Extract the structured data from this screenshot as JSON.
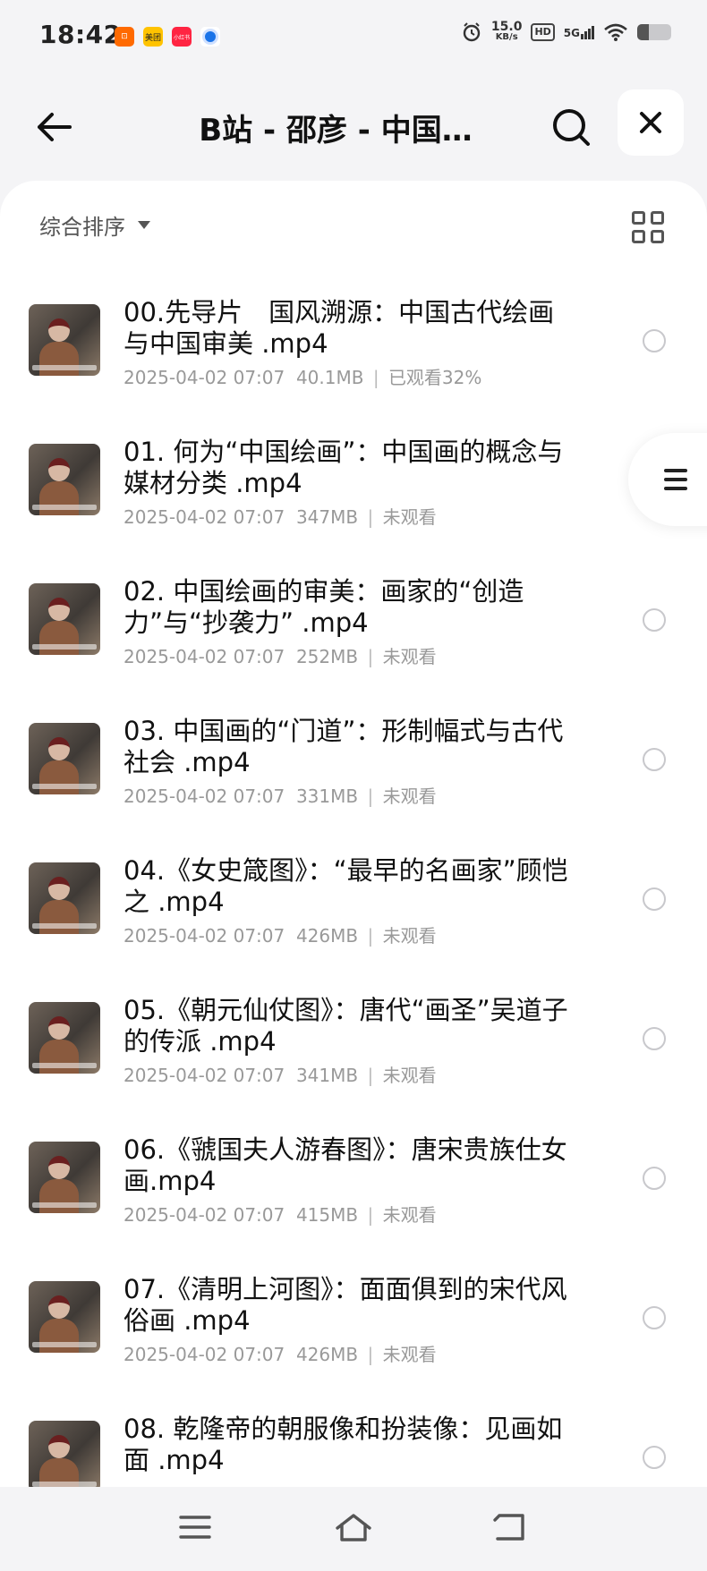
{
  "status_bar": {
    "time": "18:42",
    "apps": [
      {
        "icon": "taobao-app-icon",
        "color": "#ff6a00",
        "label": ""
      },
      {
        "icon": "meituan-app-icon",
        "color": "#ffc300",
        "label": "美团"
      },
      {
        "icon": "xiaohongshu-app-icon",
        "color": "#ff2442",
        "label": "小红书"
      },
      {
        "icon": "blue-app-icon",
        "color": "#1a73e8",
        "label": ""
      }
    ],
    "net_speed_value": "15.0",
    "net_speed_unit": "KB/s",
    "hd_badge": "HD",
    "network": "5G",
    "battery_level": 0.35
  },
  "header": {
    "title": "B站 - 邵彦 - 中国…"
  },
  "sort": {
    "label": "综合排序"
  },
  "files": [
    {
      "name": "00.先导片　国风溯源：中国古代绘画与中国审美 .mp4",
      "date": "2025-04-02 07:07",
      "size": "40.1MB",
      "status": "已观看32%"
    },
    {
      "name": "01. 何为“中国绘画”：中国画的概念与媒材分类 .mp4",
      "date": "2025-04-02 07:07",
      "size": "347MB",
      "status": "未观看"
    },
    {
      "name": "02. 中国绘画的审美：画家的“创造力”与“抄袭力” .mp4",
      "date": "2025-04-02 07:07",
      "size": "252MB",
      "status": "未观看"
    },
    {
      "name": "03. 中国画的“门道”：形制幅式与古代社会 .mp4",
      "date": "2025-04-02 07:07",
      "size": "331MB",
      "status": "未观看"
    },
    {
      "name": "04.《女史箴图》：“最早的名画家”顾恺之 .mp4",
      "date": "2025-04-02 07:07",
      "size": "426MB",
      "status": "未观看"
    },
    {
      "name": "05.《朝元仙仗图》：唐代“画圣”吴道子的传派 .mp4",
      "date": "2025-04-02 07:07",
      "size": "341MB",
      "status": "未观看"
    },
    {
      "name": "06.《虢国夫人游春图》：唐宋贵族仕女画.mp4",
      "date": "2025-04-02 07:07",
      "size": "415MB",
      "status": "未观看"
    },
    {
      "name": "07.《清明上河图》：面面俱到的宋代风俗画 .mp4",
      "date": "2025-04-02 07:07",
      "size": "426MB",
      "status": "未观看"
    },
    {
      "name": "08. 乾隆帝的朝服像和扮装像：见画如面 .mp4",
      "date": "",
      "size": "",
      "status": ""
    }
  ],
  "meta_separator": "|",
  "nav_bar": {
    "buttons": [
      "menu-icon",
      "home-icon",
      "back-icon"
    ]
  }
}
